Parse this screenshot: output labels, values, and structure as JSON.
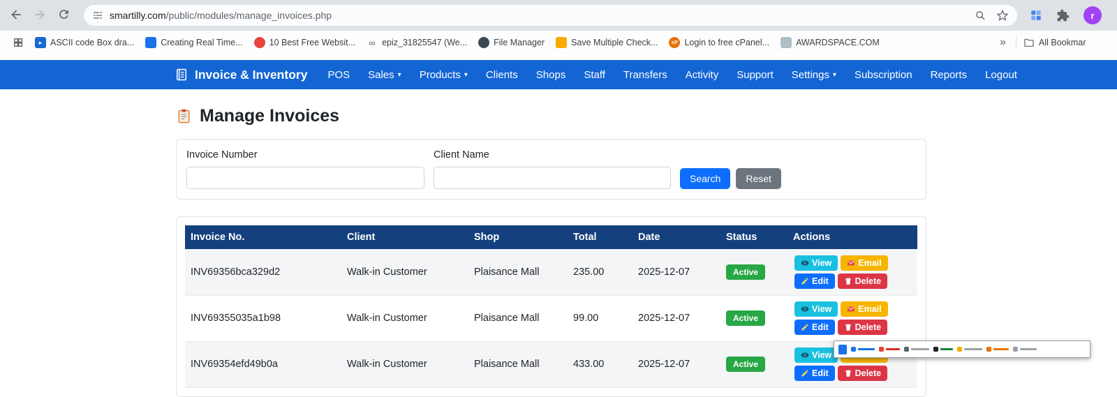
{
  "colors": {
    "navbar": "#1365d4",
    "table_header": "#14417e",
    "active": "#28a745",
    "view": "#1ac0e0",
    "email": "#f7b500",
    "edit": "#0d6efd",
    "delete": "#dc3545",
    "search": "#0d6efd",
    "reset": "#6c757d",
    "avatar": "#a142f4"
  },
  "browser": {
    "url_domain": "smartilly.com",
    "url_path": "/public/modules/manage_invoices.php",
    "avatar_letter": "r",
    "overflow_chevron": "»",
    "all_bookmarks_label": "All Bookmar",
    "bookmarks": [
      {
        "label": "ASCII code Box dra..."
      },
      {
        "label": "Creating Real Time..."
      },
      {
        "label": "10 Best Free Websit..."
      },
      {
        "label": "epiz_31825547 (We..."
      },
      {
        "label": "File Manager"
      },
      {
        "label": "Save Multiple Check..."
      },
      {
        "label": "Login to free cPanel..."
      },
      {
        "label": "AWARDSPACE.COM"
      }
    ]
  },
  "navbar": {
    "brand": "Invoice & Inventory",
    "items": [
      {
        "label": "POS"
      },
      {
        "label": "Sales",
        "caret": "▾"
      },
      {
        "label": "Products",
        "caret": "▾"
      },
      {
        "label": "Clients"
      },
      {
        "label": "Shops"
      },
      {
        "label": "Staff"
      },
      {
        "label": "Transfers"
      },
      {
        "label": "Activity"
      },
      {
        "label": "Support"
      },
      {
        "label": "Settings",
        "caret": "▾"
      },
      {
        "label": "Subscription"
      },
      {
        "label": "Reports"
      },
      {
        "label": "Logout"
      }
    ]
  },
  "page": {
    "title": "Manage Invoices",
    "filter": {
      "invoice_label": "Invoice Number",
      "client_label": "Client Name",
      "search": "Search",
      "reset": "Reset"
    },
    "table": {
      "headers": [
        "Invoice No.",
        "Client",
        "Shop",
        "Total",
        "Date",
        "Status",
        "Actions"
      ],
      "actions": {
        "view": "View",
        "email": "Email",
        "edit": "Edit",
        "delete": "Delete"
      },
      "rows": [
        {
          "invoice_no": "INV69356bca329d2",
          "client": "Walk-in Customer",
          "shop": "Plaisance Mall",
          "total": "235.00",
          "date": "2025-12-07",
          "status": "Active"
        },
        {
          "invoice_no": "INV69355035a1b98",
          "client": "Walk-in Customer",
          "shop": "Plaisance Mall",
          "total": "99.00",
          "date": "2025-12-07",
          "status": "Active"
        },
        {
          "invoice_no": "INV69354efd49b0a",
          "client": "Walk-in Customer",
          "shop": "Plaisance Mall",
          "total": "433.00",
          "date": "2025-12-07",
          "status": "Active"
        }
      ]
    }
  }
}
